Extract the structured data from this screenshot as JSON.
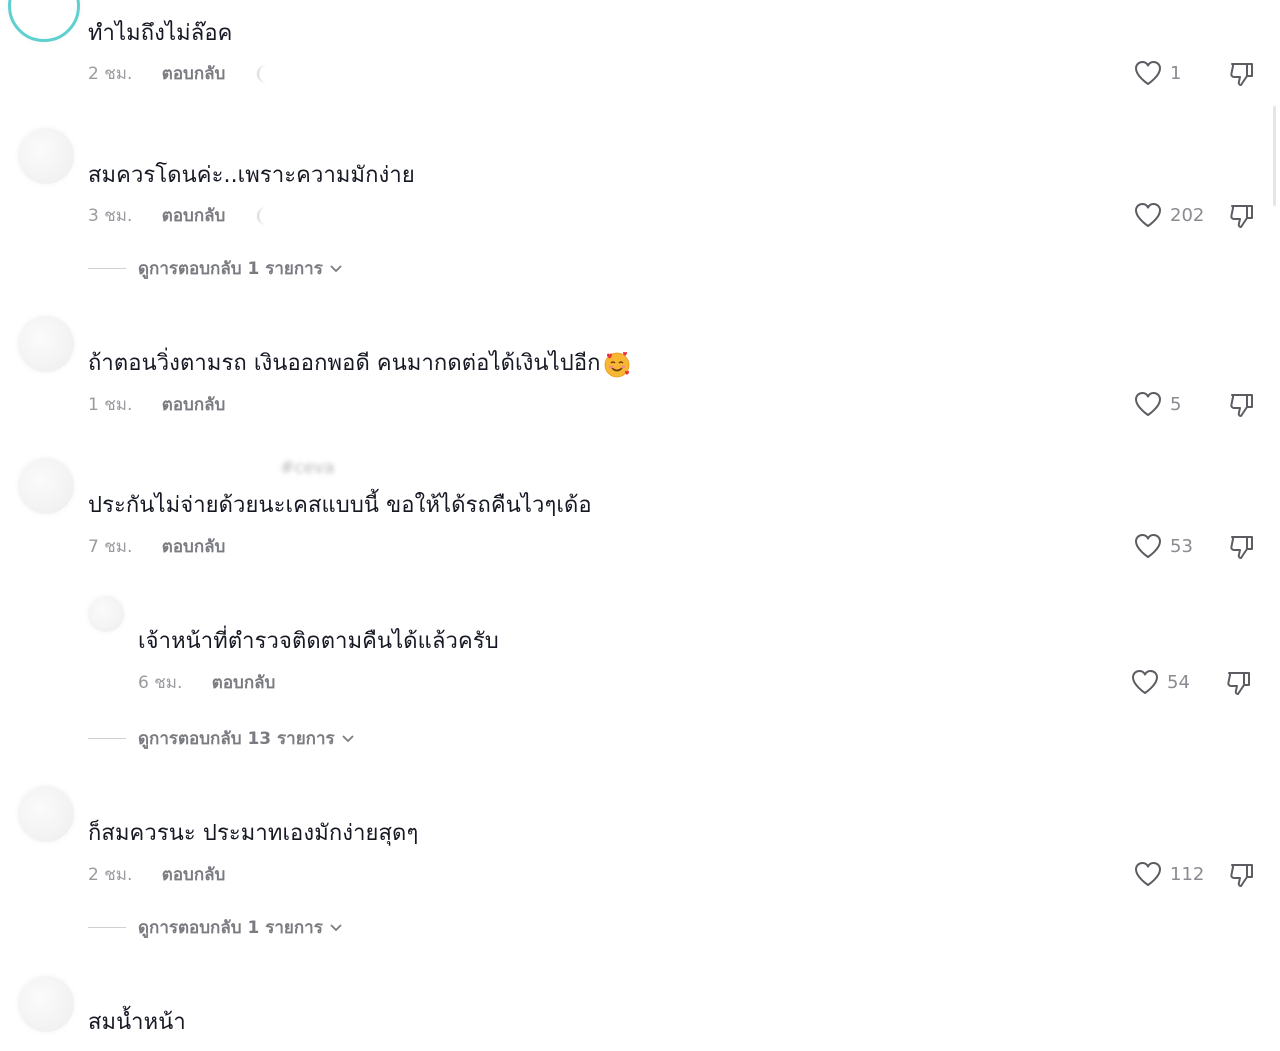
{
  "comments": [
    {
      "username": "",
      "text": "ทำไมถึงไม่ล๊อค",
      "time": "2 ชม.",
      "reply": "ตอบกลับ",
      "likes": "1"
    },
    {
      "username": "",
      "text": "สมควรโดนค่ะ..เพราะความมักง่าย",
      "time": "3 ชม.",
      "reply": "ตอบกลับ",
      "likes": "202",
      "view_replies": "ดูการตอบกลับ 1 รายการ"
    },
    {
      "username": "",
      "text": "ถ้าตอนวิ่งตามรถ เงินออกพอดี คนมากดต่อได้เงินไปอีก",
      "time": "1 ชม.",
      "reply": "ตอบกลับ",
      "likes": "5"
    },
    {
      "username": "#ceva",
      "text": "ประกันไม่จ่ายด้วยนะเคสแบบนี้ ขอให้ได้รถคืนไวๆเด้อ",
      "time": "7 ชม.",
      "reply": "ตอบกลับ",
      "likes": "53"
    },
    {
      "username": "",
      "text": "เจ้าหน้าที่ตำรวจติดตามคืนได้แล้วครับ",
      "time": "6 ชม.",
      "reply": "ตอบกลับ",
      "likes": "54",
      "view_replies": "ดูการตอบกลับ 13 รายการ"
    },
    {
      "username": "",
      "text": "ก็สมควรนะ ประมาทเองมักง่ายสุดๆ",
      "time": "2 ชม.",
      "reply": "ตอบกลับ",
      "likes": "112",
      "view_replies": "ดูการตอบกลับ 1 รายการ"
    },
    {
      "username": "",
      "text": "สมน้ำหน้า"
    }
  ],
  "icons": {
    "like": "heart-outline-icon",
    "dislike": "thumbs-down-outline-icon",
    "expand": "chevron-down-icon",
    "emoji": "smiling-face-with-hearts-emoji"
  },
  "colors": {
    "text": "#161823",
    "meta": "#9a9ba0",
    "reply": "#7b7c82",
    "icon": "#5c5d63",
    "avatar_ring": "#5fd0d0"
  }
}
